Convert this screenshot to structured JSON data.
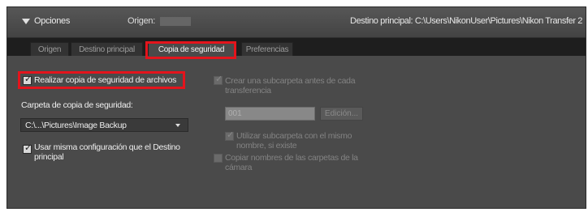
{
  "header": {
    "title": "Opciones",
    "origin_label": "Origen:",
    "destination": "Destino principal: C:\\Users\\NikonUser\\Pictures\\Nikon Transfer 2"
  },
  "tabs": [
    {
      "label": "Origen",
      "active": false
    },
    {
      "label": "Destino principal",
      "active": false
    },
    {
      "label": "Copia de seguridad",
      "active": true
    },
    {
      "label": "Preferencias",
      "active": false
    }
  ],
  "backup": {
    "enable_label": "Realizar copia de seguridad de archivos",
    "enable_checked": true,
    "folder_label": "Carpeta de copia de seguridad:",
    "folder_value": "C:\\...\\Pictures\\Image Backup",
    "same_config_label_line1": "Usar misma configuración que el Destino",
    "same_config_label_line2": "principal",
    "same_config_checked": true
  },
  "subfolder": {
    "create_label_line1": "Crear una subcarpeta antes de cada",
    "create_label_line2": "transferencia",
    "create_checked": true,
    "number_value": "001",
    "edit_label": "Edición...",
    "use_existing_label_line1": "Utilizar subcarpeta con el mismo",
    "use_existing_label_line2": "nombre, si existe",
    "use_existing_checked": true,
    "copy_names_label_line1": "Copiar nombres de las carpetas de la",
    "copy_names_label_line2": "cámara",
    "copy_names_checked": false
  },
  "colors": {
    "highlight": "#e4141c",
    "panel": "#4a4a4a",
    "tab_bar": "#1e1e1e"
  },
  "icons": {
    "collapse": "triangle-down",
    "dropdown": "triangle-down",
    "checkbox": "checkmark"
  }
}
